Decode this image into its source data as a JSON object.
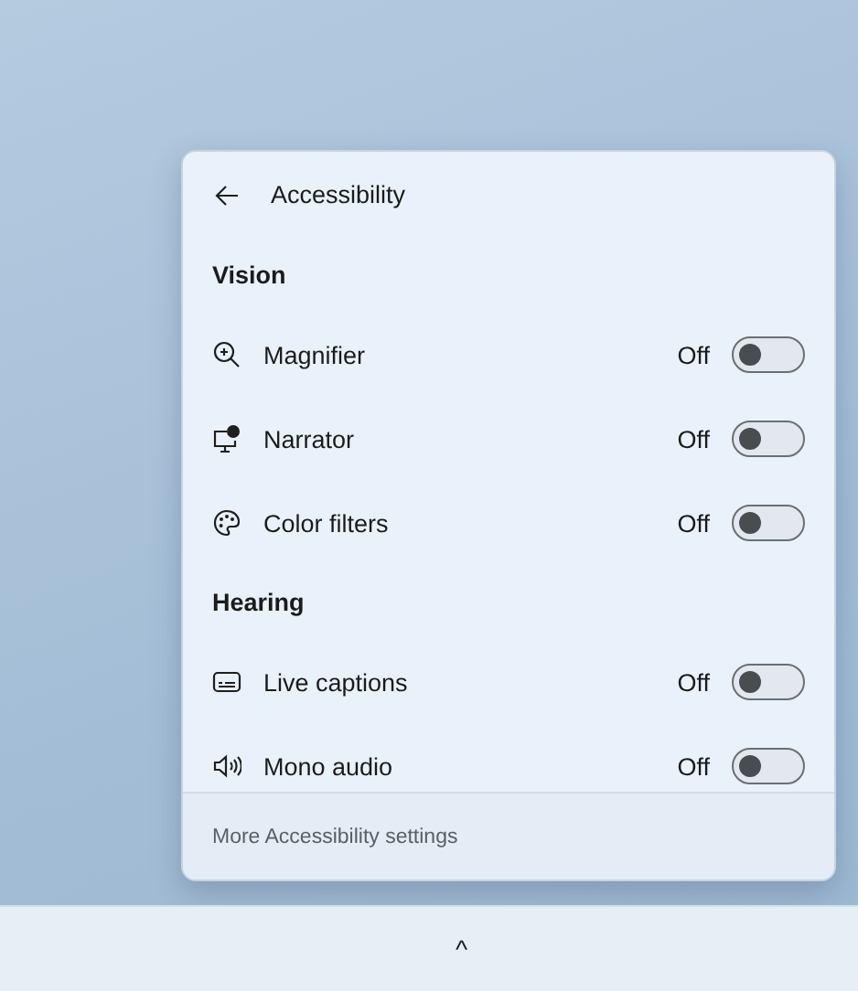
{
  "panel": {
    "title": "Accessibility",
    "sections": [
      {
        "heading": "Vision",
        "items": [
          {
            "kind": "magnifier",
            "label": "Magnifier",
            "state": "Off",
            "on": false
          },
          {
            "kind": "narrator",
            "label": "Narrator",
            "state": "Off",
            "on": false
          },
          {
            "kind": "filters",
            "label": "Color filters",
            "state": "Off",
            "on": false
          }
        ]
      },
      {
        "heading": "Hearing",
        "items": [
          {
            "kind": "captions",
            "label": "Live captions",
            "state": "Off",
            "on": false
          },
          {
            "kind": "audio",
            "label": "Mono audio",
            "state": "Off",
            "on": false
          }
        ]
      }
    ],
    "footer": "More Accessibility settings"
  },
  "taskbar": {
    "overflow": "^"
  }
}
